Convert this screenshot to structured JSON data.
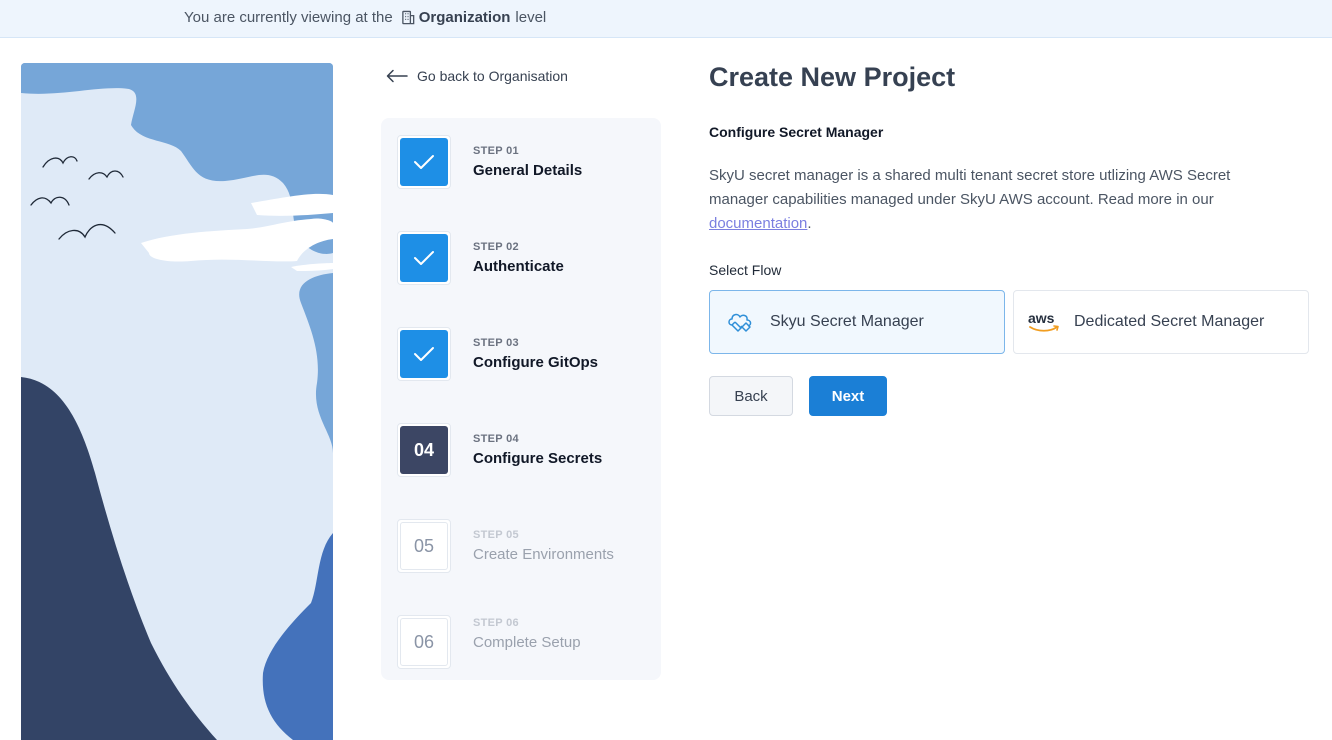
{
  "banner": {
    "prefix": "You are currently viewing at the",
    "level_name": "Organization",
    "suffix": "level"
  },
  "back_link": {
    "label": "Go back to Organisation"
  },
  "steps": [
    {
      "tag": "STEP 01",
      "title": "General Details",
      "status": "done",
      "number": ""
    },
    {
      "tag": "STEP 02",
      "title": "Authenticate",
      "status": "done",
      "number": ""
    },
    {
      "tag": "STEP 03",
      "title": "Configure GitOps",
      "status": "done",
      "number": ""
    },
    {
      "tag": "STEP 04",
      "title": "Configure Secrets",
      "status": "current",
      "number": "04"
    },
    {
      "tag": "STEP 05",
      "title": "Create Environments",
      "status": "pending",
      "number": "05"
    },
    {
      "tag": "STEP 06",
      "title": "Complete Setup",
      "status": "pending",
      "number": "06"
    }
  ],
  "main": {
    "title": "Create New Project",
    "subtitle": "Configure Secret Manager",
    "description": "SkyU secret manager is a shared multi tenant secret store utlizing AWS Secret manager capabilities managed under SkyU AWS account. Read more in our",
    "doc_link": "documentation",
    "doc_suffix": ".",
    "flow_label": "Select Flow",
    "flows": [
      {
        "label": "Skyu Secret Manager",
        "icon": "skyu-cloud-icon",
        "selected": true
      },
      {
        "label": "Dedicated Secret Manager",
        "icon": "aws-logo-icon",
        "selected": false
      }
    ],
    "back_button": "Back",
    "next_button": "Next"
  },
  "colors": {
    "accent": "#1b7fd6",
    "step_done": "#1e8fe6",
    "step_current": "#3c4664",
    "banner_bg": "#eef5fd"
  }
}
